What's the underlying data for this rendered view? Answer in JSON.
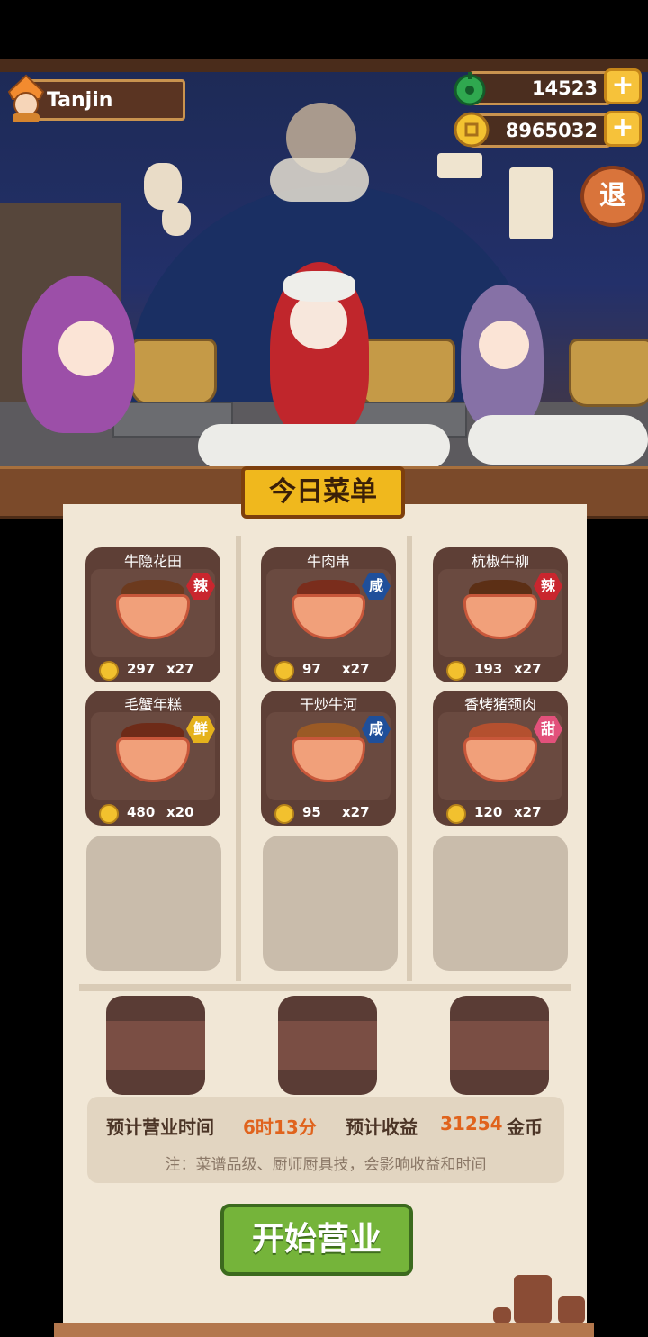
{
  "player": {
    "name": "Tanjin"
  },
  "currency": {
    "jade": "14523",
    "gold": "8965032",
    "plus": "+"
  },
  "exit_label": "退",
  "menu": {
    "title": "今日菜单",
    "dishes": [
      {
        "name": "牛隐花田",
        "tag": "辣",
        "price": "297",
        "qty": "x27",
        "tag_color": "#c9262e"
      },
      {
        "name": "牛肉串",
        "tag": "咸",
        "price": "97",
        "qty": "x27",
        "tag_color": "#1f4f9a"
      },
      {
        "name": "杭椒牛柳",
        "tag": "辣",
        "price": "193",
        "qty": "x27",
        "tag_color": "#c9262e"
      },
      {
        "name": "毛蟹年糕",
        "tag": "鲜",
        "price": "480",
        "qty": "x20",
        "tag_color": "#e5b21c"
      },
      {
        "name": "干炒牛河",
        "tag": "咸",
        "price": "95",
        "qty": "x27",
        "tag_color": "#1f4f9a"
      },
      {
        "name": "香烤猪颈肉",
        "tag": "甜",
        "price": "120",
        "qty": "x27",
        "tag_color": "#e2517b"
      }
    ]
  },
  "summary": {
    "time_label": "预计营业时间",
    "time_value": "6时13分",
    "income_label": "预计收益",
    "income_value": "31254",
    "income_unit": "金币",
    "note": "注：菜谱品级、厨师厨具技，会影响收益和时间"
  },
  "start_button": "开始营业"
}
